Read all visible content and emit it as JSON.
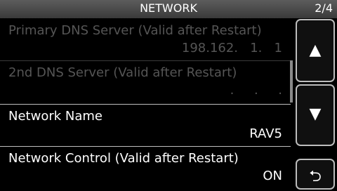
{
  "header": {
    "title": "NETWORK",
    "page_indicator": "2/4"
  },
  "items": [
    {
      "label": "Primary DNS Server (Valid after Restart)",
      "value": "198.162.   1.   1",
      "enabled": false
    },
    {
      "label": "2nd DNS Server (Valid after Restart)",
      "value": ".     .     .",
      "enabled": false
    },
    {
      "label": "Network Name",
      "value": "RAV5",
      "enabled": true
    },
    {
      "label": "Network Control (Valid after Restart)",
      "value": "ON",
      "enabled": true
    }
  ],
  "buttons": {
    "up": "▲",
    "down": "▼",
    "back": "⮌"
  },
  "colors": {
    "text": "#ffffff",
    "dim_text": "#555555",
    "background": "#000000"
  }
}
